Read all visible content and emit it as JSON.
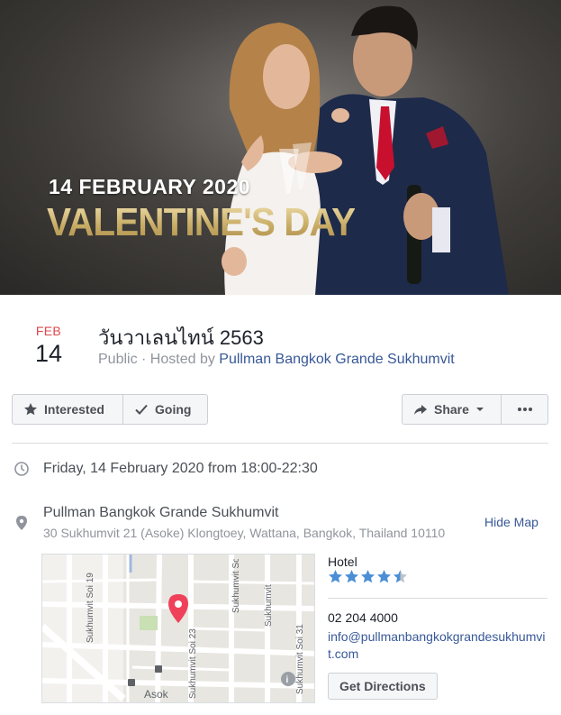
{
  "cover": {
    "date_text": "14 FEBRUARY 2020",
    "title_text": "VALENTINE'S DAY"
  },
  "event": {
    "month": "FEB",
    "day": "14",
    "title": "วันวาเลนไทน์ 2563",
    "visibility": "Public",
    "hosted_by_prefix": " · Hosted by ",
    "host": "Pullman Bangkok Grande Sukhumvit"
  },
  "actions": {
    "interested": "Interested",
    "going": "Going",
    "share": "Share"
  },
  "details": {
    "when": "Friday, 14 February 2020 from 18:00-22:30",
    "venue_name": "Pullman Bangkok Grande Sukhumvit",
    "venue_address": "30 Sukhumvit 21 (Asoke) Klongtoey, Wattana, Bangkok, Thailand 10110",
    "hide_map": "Hide Map"
  },
  "map": {
    "labels": [
      "Sukhumvit Soi 19",
      "Sukhumvit Soi 23",
      "Sukhumvit Soi 31",
      "Sukhumvit",
      "Asok"
    ],
    "pin_color": "#f0415a"
  },
  "place_info": {
    "category": "Hotel",
    "rating": 4.5,
    "rating_max": 5,
    "phone": "02 204 4000",
    "email": "info@pullmanbangkokgrandesukhumvit.com",
    "directions_button": "Get Directions"
  },
  "colors": {
    "link": "#385898",
    "accent_month": "#e0474c",
    "star": "#4c8fd6"
  }
}
